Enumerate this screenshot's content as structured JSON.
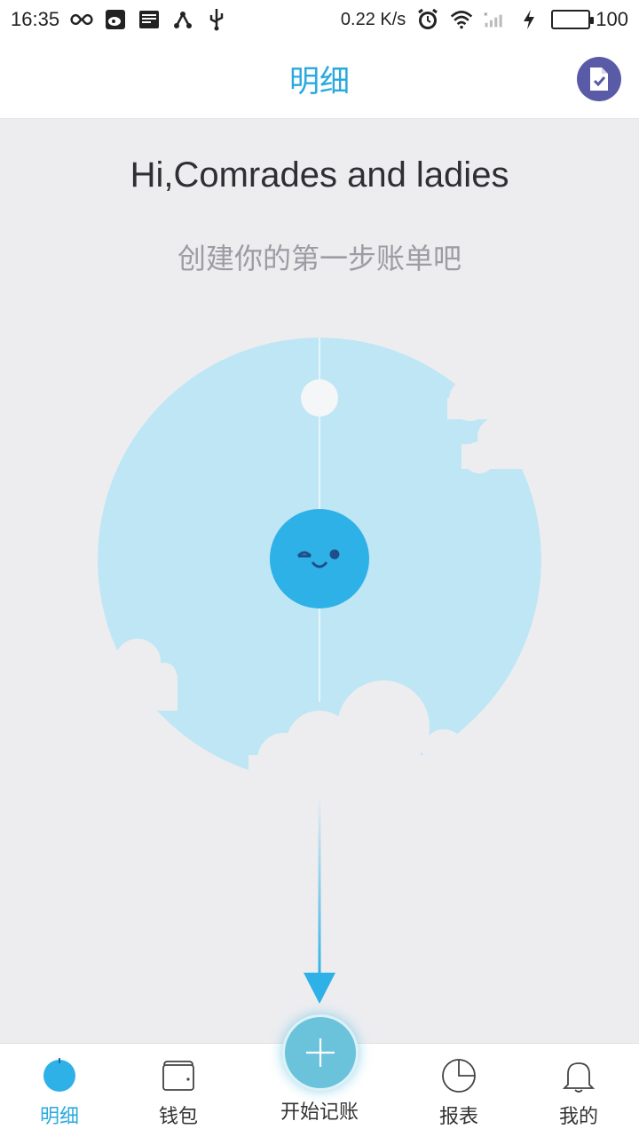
{
  "status_bar": {
    "time": "16:35",
    "speed": "0.22 K/s",
    "battery": "100"
  },
  "app_bar": {
    "title": "明细",
    "action_icon": "checklist-icon"
  },
  "content": {
    "greeting": "Hi,Comrades and ladies",
    "subtitle": "创建你的第一步账单吧"
  },
  "bottom_nav": {
    "items": [
      {
        "label": "明细",
        "icon": "detail-icon",
        "active": true
      },
      {
        "label": "钱包",
        "icon": "wallet-icon",
        "active": false
      },
      {
        "label": "开始记账",
        "icon": "plus-icon",
        "active": false
      },
      {
        "label": "报表",
        "icon": "pie-chart-icon",
        "active": false
      },
      {
        "label": "我的",
        "icon": "bell-icon",
        "active": false
      }
    ]
  },
  "colors": {
    "accent": "#2AA9DE",
    "background": "#EDEDF0",
    "sky": "#BEE6F5",
    "fab": "#6AC3DB",
    "action": "#5A5BA6"
  }
}
